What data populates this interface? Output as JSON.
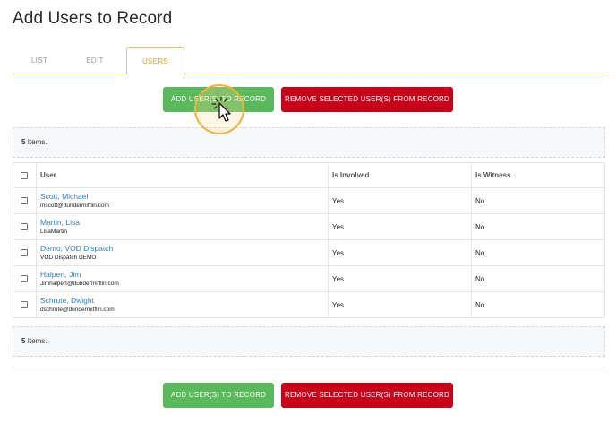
{
  "page": {
    "title": "Add Users to Record"
  },
  "tabs": [
    {
      "label": "LIST",
      "active": false
    },
    {
      "label": "EDIT",
      "active": false
    },
    {
      "label": "USERS",
      "active": true
    }
  ],
  "actions": {
    "add_label": "ADD USER(S) TO RECORD",
    "remove_label": "REMOVE SELECTED USER(S) FROM RECORD"
  },
  "summary": {
    "count": "5",
    "items_label": "Items."
  },
  "table": {
    "columns": [
      "User",
      "Is Involved",
      "Is Witness"
    ],
    "rows": [
      {
        "name": "Scott, Michael",
        "email": "mscott@dundermifflin.com",
        "involved": "Yes",
        "witness": "No"
      },
      {
        "name": "Martin, Lisa",
        "email": "LisaMartin",
        "involved": "Yes",
        "witness": "No"
      },
      {
        "name": "Demo, VOD Dispatch",
        "email": "VOD Dispatch DEMO",
        "involved": "Yes",
        "witness": "No"
      },
      {
        "name": "Halpert, Jim",
        "email": "Jimhalpert@dundermifflin.com",
        "involved": "Yes",
        "witness": "No"
      },
      {
        "name": "Schrute, Dwight",
        "email": "dschrute@dundermifflin.com",
        "involved": "Yes",
        "witness": "No"
      }
    ]
  },
  "colors": {
    "accent": "#e3a321",
    "add": "#5cb85c",
    "remove": "#c9001a",
    "link": "#2f7fbd"
  },
  "icons": {
    "cursor": "pointer-cursor-icon"
  }
}
